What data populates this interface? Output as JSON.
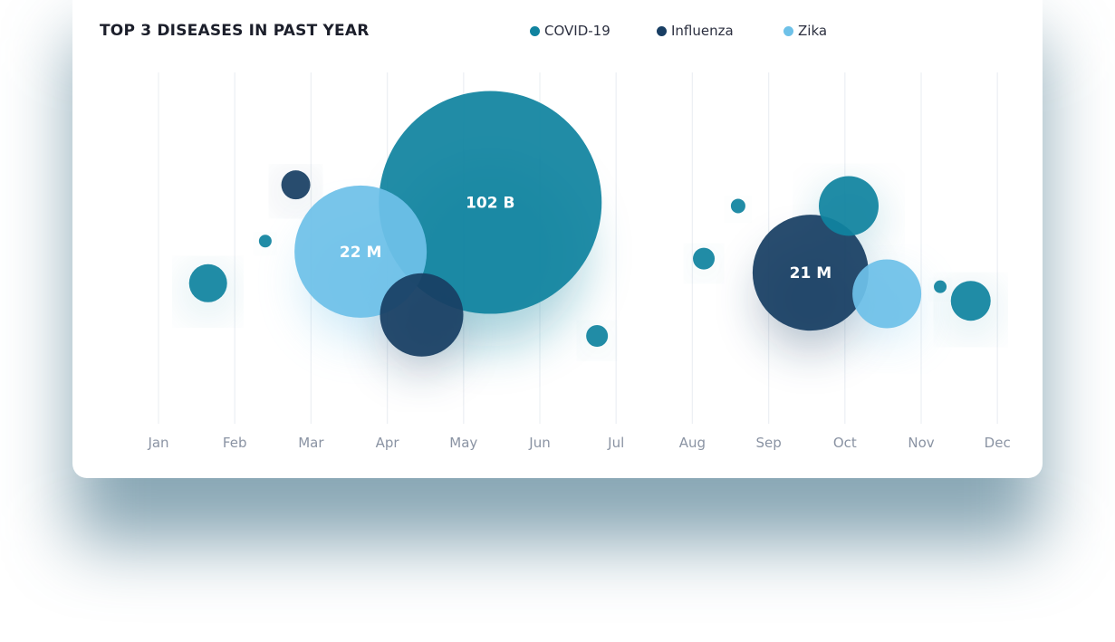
{
  "chart_data": {
    "type": "scatter",
    "subtype": "bubble",
    "title": "TOP 3 DISEASES IN PAST YEAR",
    "categories": [
      "Jan",
      "Feb",
      "Mar",
      "Apr",
      "May",
      "Jun",
      "Jul",
      "Aug",
      "Sep",
      "Oct",
      "Nov",
      "Dec"
    ],
    "grid": "vertical",
    "legend_position": "top",
    "series": [
      {
        "name": "COVID-19",
        "color": "#10839f",
        "points": [
          {
            "x": 1.65,
            "y": 0.4,
            "r": 21
          },
          {
            "x": 2.4,
            "y": 0.52,
            "r": 7
          },
          {
            "x": 5.35,
            "y": 0.63,
            "r": 123,
            "label": "102 B"
          },
          {
            "x": 6.75,
            "y": 0.25,
            "r": 12
          },
          {
            "x": 8.15,
            "y": 0.47,
            "r": 12
          },
          {
            "x": 8.6,
            "y": 0.62,
            "r": 8
          },
          {
            "x": 10.05,
            "y": 0.62,
            "r": 33
          },
          {
            "x": 11.25,
            "y": 0.39,
            "r": 7
          },
          {
            "x": 11.65,
            "y": 0.35,
            "r": 22
          }
        ]
      },
      {
        "name": "Influenza",
        "color": "#183e63",
        "points": [
          {
            "x": 2.8,
            "y": 0.68,
            "r": 16
          },
          {
            "x": 4.45,
            "y": 0.31,
            "r": 46
          },
          {
            "x": 9.55,
            "y": 0.43,
            "r": 64,
            "label": "21 M"
          }
        ]
      },
      {
        "name": "Zika",
        "color": "#6ec1e8",
        "points": [
          {
            "x": 3.65,
            "y": 0.49,
            "r": 73,
            "label": "22 M"
          },
          {
            "x": 10.55,
            "y": 0.37,
            "r": 38
          }
        ]
      }
    ]
  }
}
